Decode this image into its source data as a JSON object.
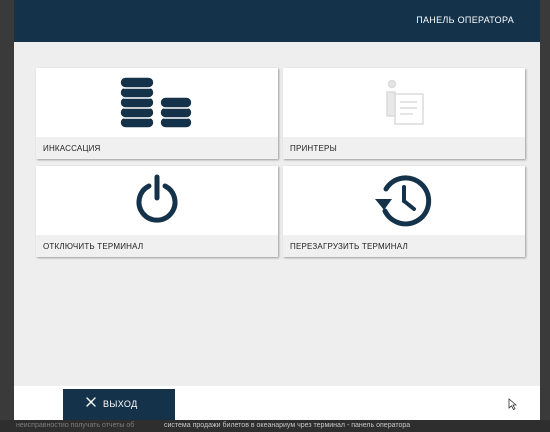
{
  "header": {
    "title": "ПАНЕЛЬ ОПЕРАТОРА"
  },
  "tiles": [
    {
      "label": "ИНКАССАЦИЯ",
      "icon": "coins-icon"
    },
    {
      "label": "ПРИНТЕРЫ",
      "icon": "printer-info-icon"
    },
    {
      "label": "ОТКЛЮЧИТЬ ТЕРМИНАЛ",
      "icon": "power-icon"
    },
    {
      "label": "ПЕРЕЗАГРУЗИТЬ ТЕРМИНАЛ",
      "icon": "restart-clock-icon"
    }
  ],
  "exit_button": {
    "label": "ВЫХОД",
    "icon": "close-icon"
  },
  "taskbar": {
    "left_text": "неисправностио получать отчеты об",
    "right_text": "система продажи билетов в океанариум чрез терминал - панель оператора"
  },
  "colors": {
    "header_bg": "#14324a",
    "icon": "#14324a",
    "panel_bg": "#eeeeee"
  }
}
